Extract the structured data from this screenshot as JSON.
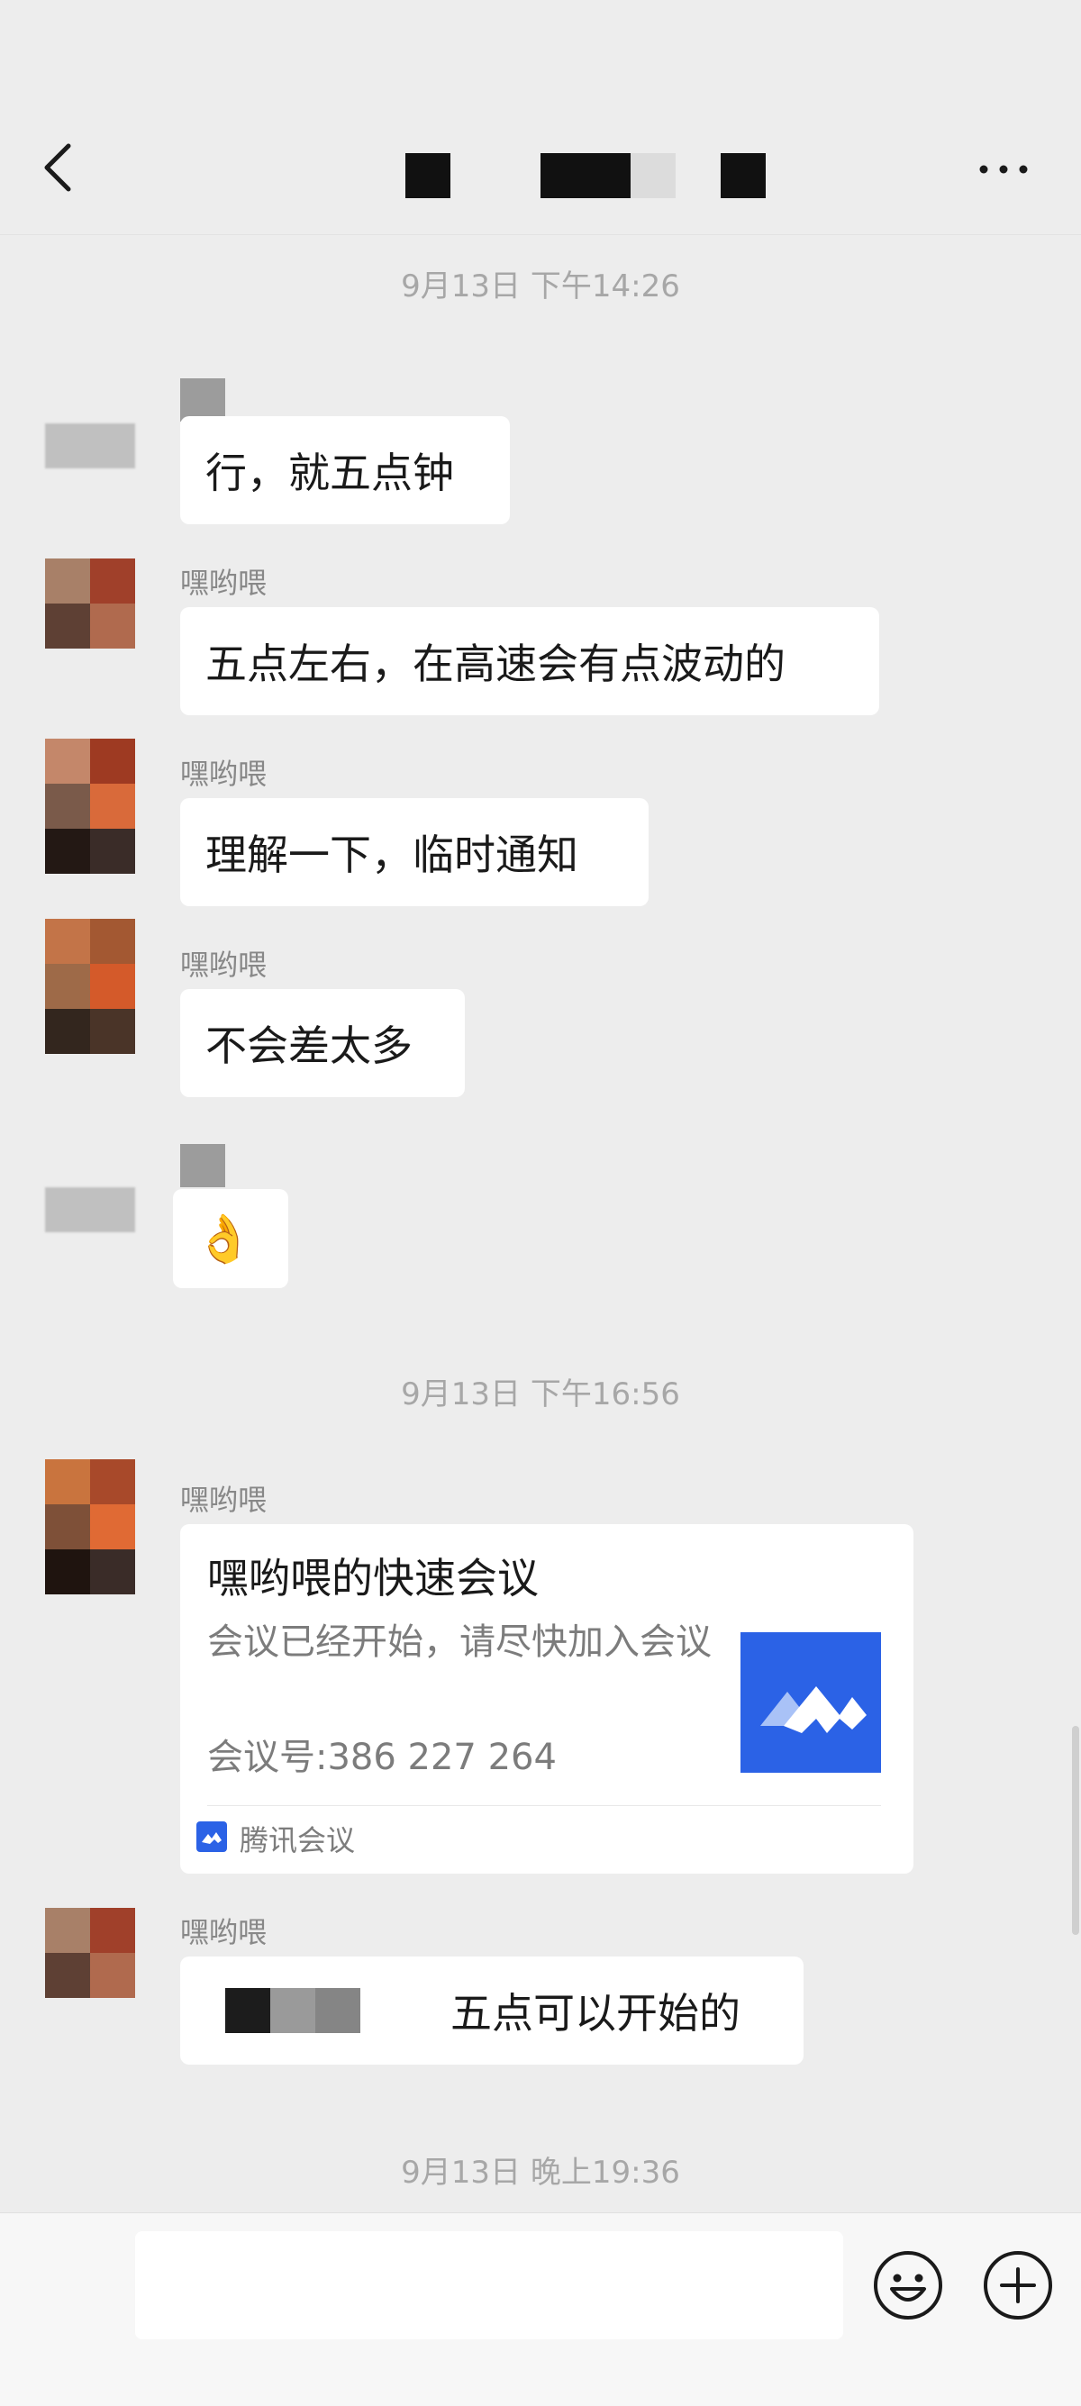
{
  "header": {
    "title_redacted": true
  },
  "timestamps": {
    "t1": "9月13日 下午14:26",
    "t2": "9月13日 下午16:56",
    "t3": "9月13日 晚上19:36"
  },
  "messages": [
    {
      "sender": "",
      "text": "行，就五点钟"
    },
    {
      "sender": "嘿哟喂",
      "text": "五点左右，在高速会有点波动的"
    },
    {
      "sender": "嘿哟喂",
      "text": "理解一下，临时通知"
    },
    {
      "sender": "嘿哟喂",
      "text": "不会差太多"
    },
    {
      "sender": "",
      "text": "👌"
    },
    {
      "sender": "嘿哟喂",
      "text": ""
    },
    {
      "sender": "嘿哟喂",
      "text": "五点可以开始的"
    }
  ],
  "meeting_card": {
    "title": "嘿哟喂的快速会议",
    "description": "会议已经开始，请尽快加入会议",
    "meeting_number": "会议号:386 227 264",
    "source": "腾讯会议"
  },
  "icons": {
    "back": "chevron-left-icon",
    "more": "more-icon",
    "emoji": "emoji-icon",
    "plus": "plus-icon",
    "meeting_logo": "tencent-meeting-icon"
  },
  "colors": {
    "background": "#ededed",
    "bubble": "#ffffff",
    "meeting_blue": "#2b62e6"
  }
}
